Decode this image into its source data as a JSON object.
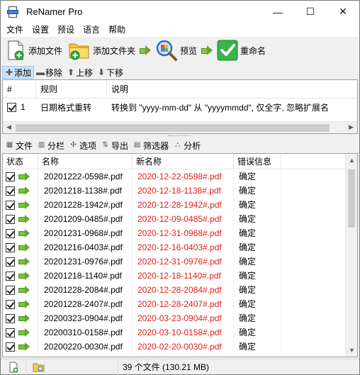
{
  "window": {
    "title": "ReNamer Pro",
    "minimize": "—",
    "maximize": "☐",
    "close": "✕"
  },
  "menu": [
    "文件",
    "设置",
    "预设",
    "语言",
    "帮助"
  ],
  "toolbar": {
    "add_files": "添加文件",
    "add_folders": "添加文件夹",
    "preview": "预览",
    "rename": "重命名"
  },
  "rulebar": {
    "add": "添加",
    "remove": "移除",
    "up": "上移",
    "down": "下移"
  },
  "rules": {
    "headers": [
      "#",
      "规则",
      "说明"
    ],
    "rows": [
      {
        "index": "1",
        "rule": "日期格式重转",
        "desc": "转换到 \"yyyy-mm-dd\" 从 \"yyyymmdd\", 仅全字, 忽略扩展名",
        "checked": true
      }
    ]
  },
  "filebar": {
    "files": "文件",
    "columns": "分栏",
    "options": "选项",
    "export": "导出",
    "filter": "筛选器",
    "analyze": "分析"
  },
  "files": {
    "headers": [
      "状态",
      "名称",
      "新名称",
      "错误信息"
    ],
    "rows": [
      {
        "name": "20201222-0598#.pdf",
        "new": "2020-12-22-0598#.pdf",
        "err": "确定"
      },
      {
        "name": "20201218-1138#.pdf",
        "new": "2020-12-18-1138#.pdf",
        "err": "确定"
      },
      {
        "name": "20201228-1942#.pdf",
        "new": "2020-12-28-1942#.pdf",
        "err": "确定"
      },
      {
        "name": "20201209-0485#.pdf",
        "new": "2020-12-09-0485#.pdf",
        "err": "确定"
      },
      {
        "name": "20201231-0968#.pdf",
        "new": "2020-12-31-0968#.pdf",
        "err": "确定"
      },
      {
        "name": "20201216-0403#.pdf",
        "new": "2020-12-16-0403#.pdf",
        "err": "确定"
      },
      {
        "name": "20201231-0976#.pdf",
        "new": "2020-12-31-0976#.pdf",
        "err": "确定"
      },
      {
        "name": "20201218-1140#.pdf",
        "new": "2020-12-18-1140#.pdf",
        "err": "确定"
      },
      {
        "name": "20201228-2084#.pdf",
        "new": "2020-12-28-2084#.pdf",
        "err": "确定"
      },
      {
        "name": "20201228-2407#.pdf",
        "new": "2020-12-28-2407#.pdf",
        "err": "确定"
      },
      {
        "name": "20200323-0904#.pdf",
        "new": "2020-03-23-0904#.pdf",
        "err": "确定"
      },
      {
        "name": "20200310-0158#.pdf",
        "new": "2020-03-10-0158#.pdf",
        "err": "确定"
      },
      {
        "name": "20200220-0030#.pdf",
        "new": "2020-02-20-0030#.pdf",
        "err": "确定"
      }
    ]
  },
  "status": {
    "summary": "39 个文件 (130.21 MB)"
  },
  "colors": {
    "new_name": "#e0201b",
    "check_green": "#2fa33a",
    "selection": "#cce4f7"
  }
}
